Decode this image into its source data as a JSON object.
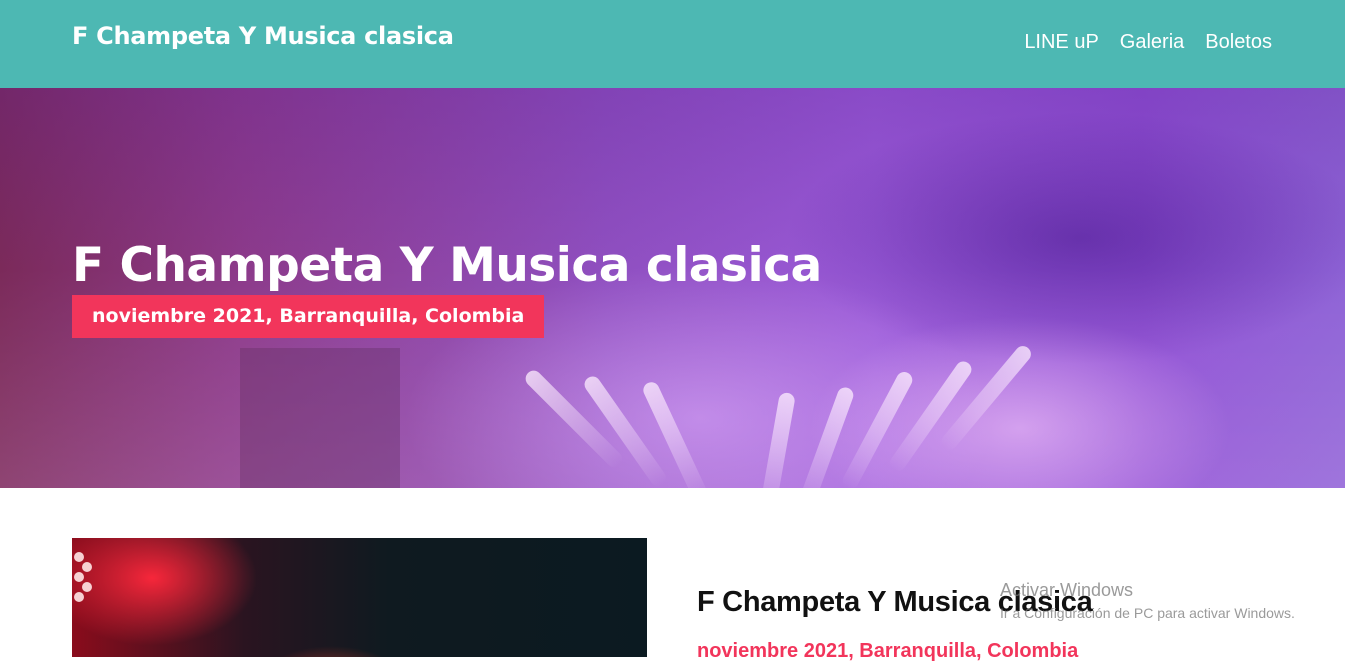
{
  "header": {
    "brand": "F Champeta Y Musica clasica",
    "nav": [
      {
        "label": "LINE uP"
      },
      {
        "label": "Galeria"
      },
      {
        "label": "Boletos"
      }
    ]
  },
  "hero": {
    "title": "F Champeta Y Musica clasica",
    "badge": "noviembre 2021, Barranquilla, Colombia"
  },
  "content": {
    "title": "F Champeta Y Musica clasica",
    "subtitle": "noviembre 2021, Barranquilla, Colombia"
  },
  "watermark": {
    "title": "Activar Windows",
    "subtitle": "Ir a Configuración de PC para activar Windows."
  },
  "colors": {
    "header_bg": "#4db8b3",
    "accent": "#f2355b"
  }
}
